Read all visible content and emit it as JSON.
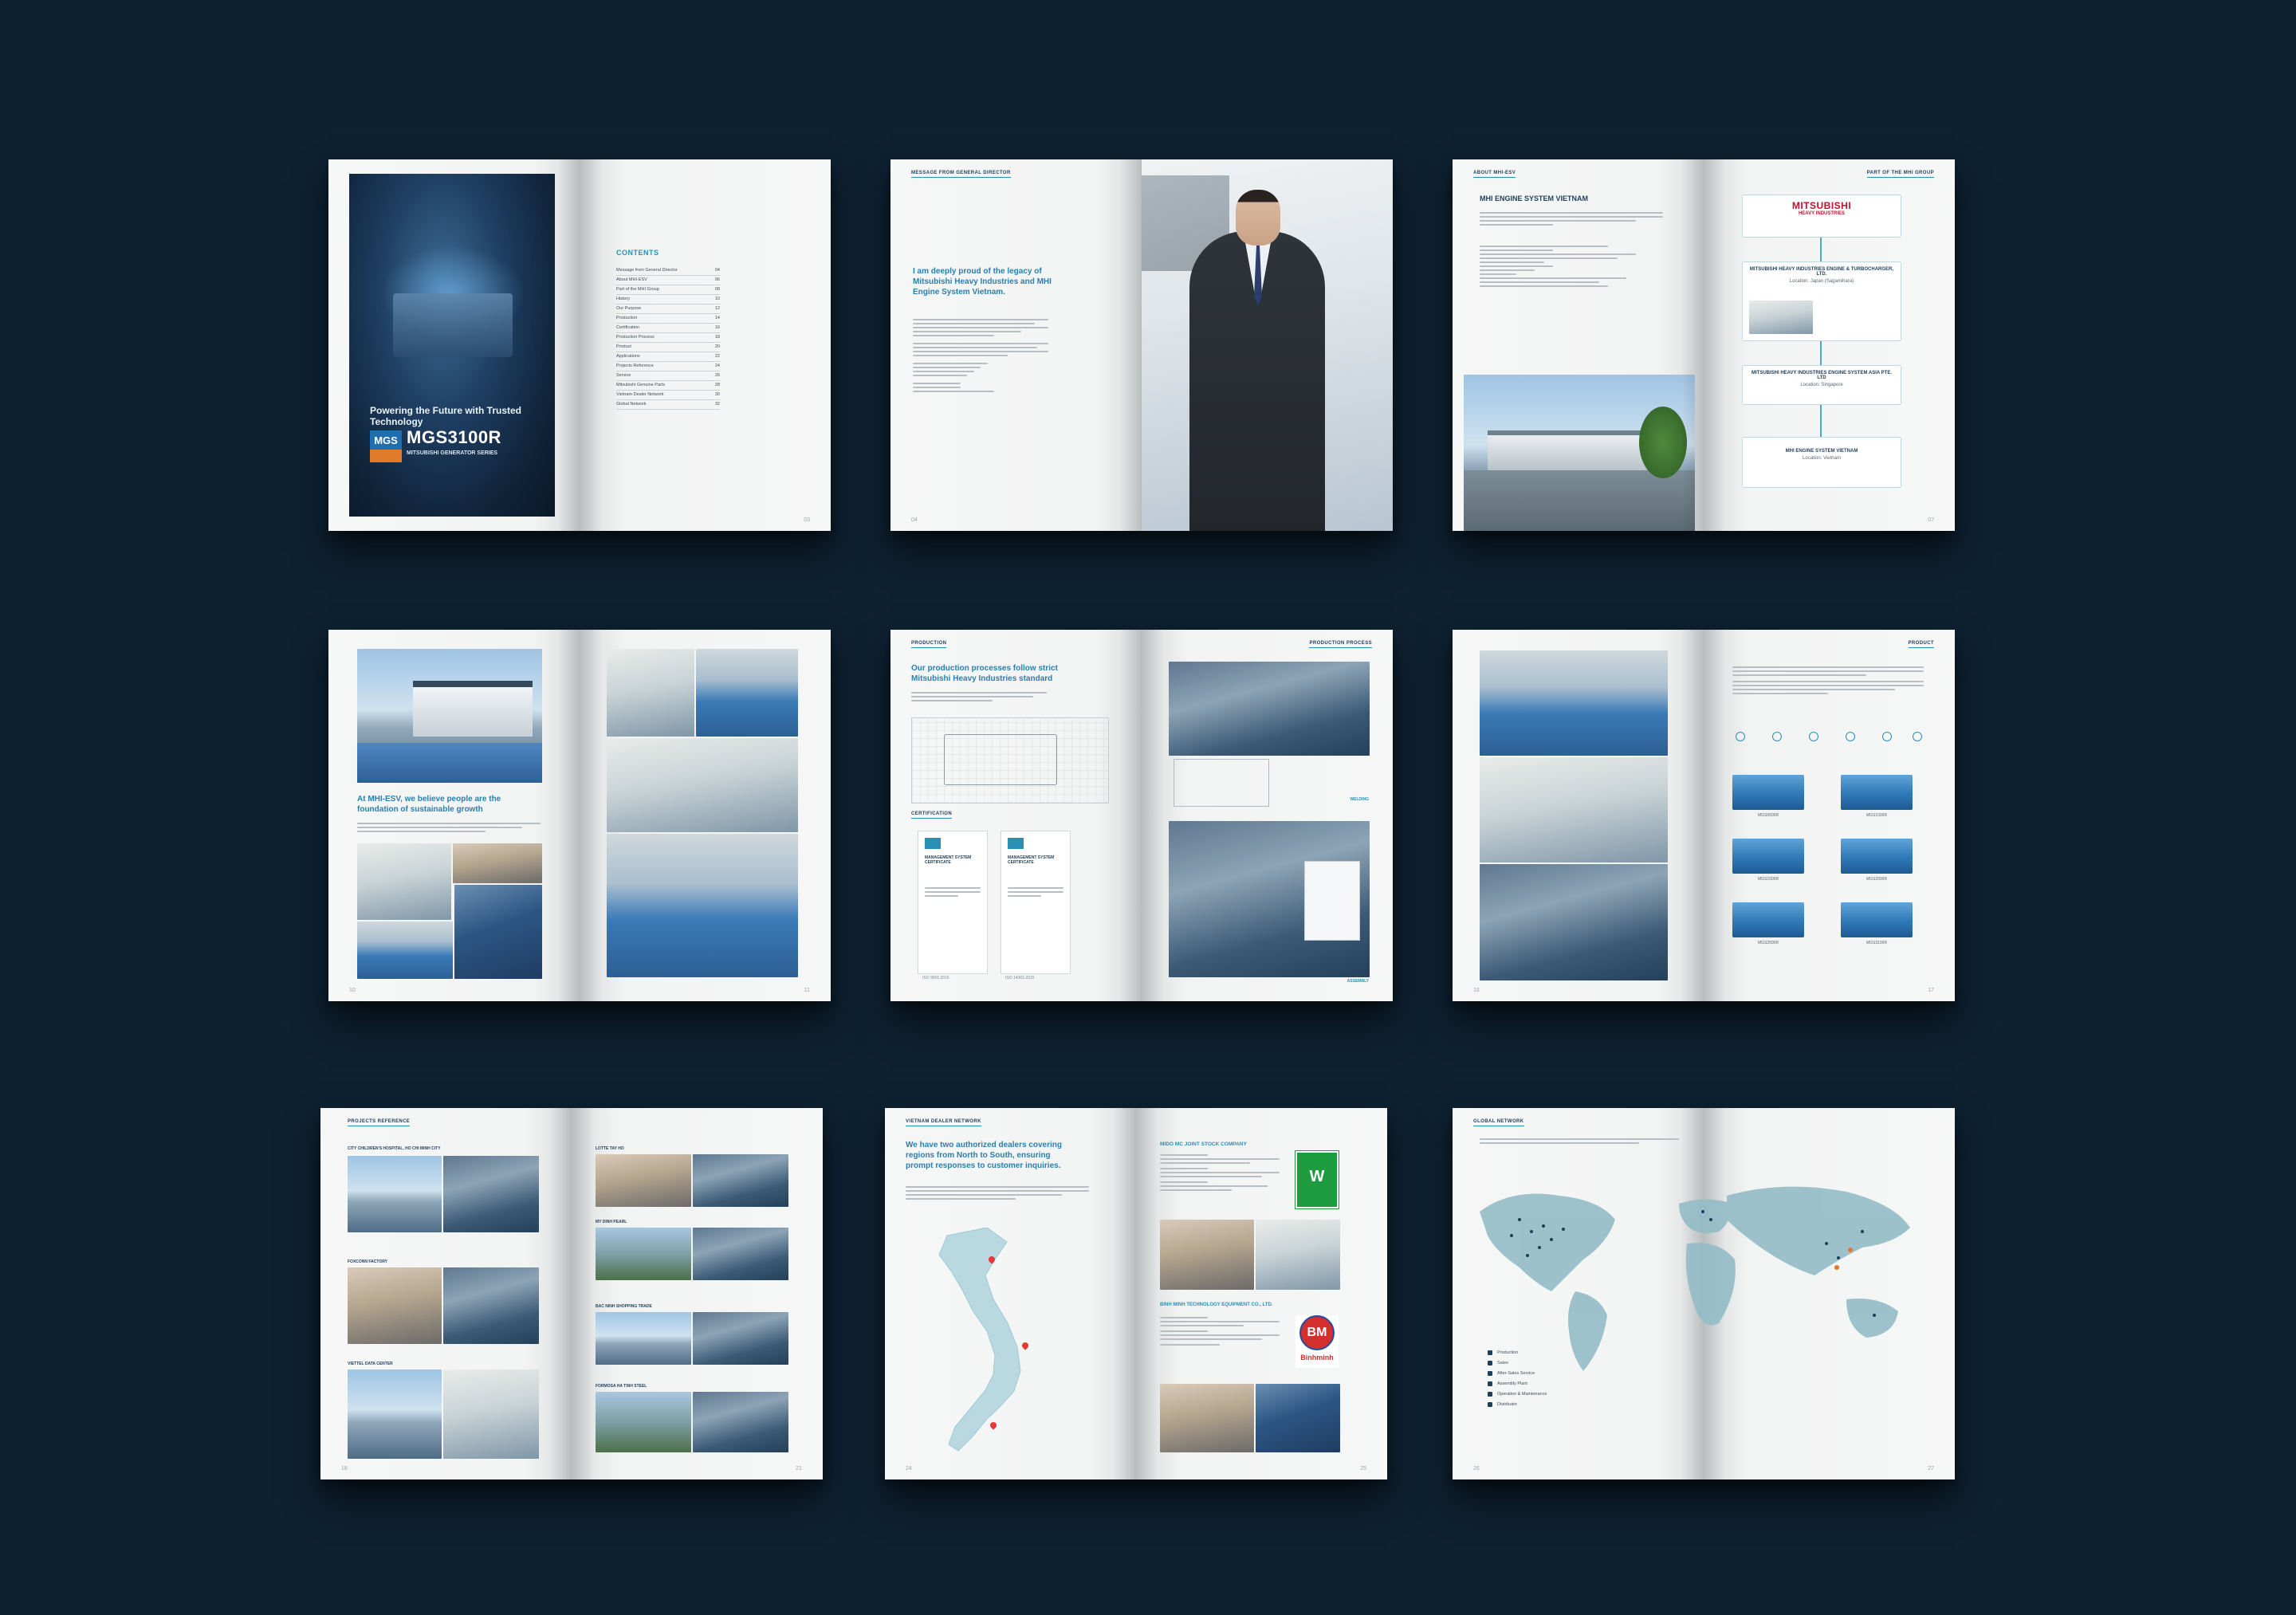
{
  "background_color": "#0e2131",
  "accent_color": "#2a8fb4",
  "spreads": {
    "cover": {
      "tagline": "Powering the Future with Trusted Technology",
      "logo_text": "MGS",
      "model": "MGS3100R",
      "series": "MITSUBISHI GENERATOR SERIES",
      "contents_title": "CONTENTS",
      "contents": [
        "Message from General Director",
        "About MHI-ESV",
        "Part of the MHI Group",
        "History",
        "Our Purpose",
        "Production",
        "Certification",
        "Production Process",
        "Product",
        "Applications",
        "Projects Reference",
        "Service",
        "Mitsubishi Genuine Parts",
        "Vietnam Dealer Network",
        "Global Network"
      ]
    },
    "director": {
      "section": "MESSAGE FROM GENERAL DIRECTOR",
      "quote": "I am deeply proud of the legacy of Mitsubishi Heavy Industries and MHI Engine System Vietnam."
    },
    "about": {
      "section": "ABOUT MHI-ESV",
      "title": "MHI ENGINE SYSTEM VIETNAM",
      "group_section": "PART OF THE MHI GROUP",
      "brand": "MITSUBISHI",
      "brand_sub": "HEAVY INDUSTRIES",
      "chain": [
        {
          "name": "MITSUBISHI HEAVY INDUSTRIES ENGINE & TURBOCHARGER, LTD.",
          "location": "Location: Japan (Sagamihara)"
        },
        {
          "name": "MITSUBISHI HEAVY INDUSTRIES ENGINE SYSTEM ASIA PTE. LTD",
          "location": "Location: Singapore"
        },
        {
          "name": "MHI ENGINE SYSTEM VIETNAM",
          "location": "Location: Vietnam"
        }
      ]
    },
    "purpose": {
      "headline": "At MHI-ESV, we believe people are the foundation of sustainable growth"
    },
    "production": {
      "section": "PRODUCTION",
      "process_section": "PRODUCTION PROCESS",
      "headline": "Our production processes follow strict Mitsubishi Heavy Industries standard",
      "cert_section": "CERTIFICATION",
      "cert_title": "MANAGEMENT SYSTEM CERTIFICATE",
      "cert_iso_1": "ISO 9001:2015",
      "cert_iso_2": "ISO 14001:2015",
      "welding": "WELDING",
      "assembly": "ASSEMBLY"
    },
    "product": {
      "section": "PRODUCT",
      "items": [
        "MGS0500R",
        "MGS1000R",
        "MGS1500R",
        "MGS2000R",
        "MGS2500R",
        "MGS3100R"
      ]
    },
    "projects": {
      "section": "PROJECTS REFERENCE",
      "items": [
        "CITY CHILDREN'S HOSPITAL, HO CHI MINH CITY",
        "FOXCONN FACTORY",
        "VIETTEL DATA CENTER",
        "LOTTE TAY HO",
        "MY DINH PEARL",
        "BAC NINH SHOPPING TRADE",
        "FORMOSA HA TINH STEEL"
      ]
    },
    "dealers": {
      "section": "VIETNAM DEALER NETWORK",
      "headline": "We have two authorized dealers covering regions from North to South, ensuring prompt responses to customer inquiries.",
      "dealer_1": "MIDO MC JOINT STOCK COMPANY",
      "dealer_1_logo": "W",
      "dealer_2": "BINH MINH TECHNOLOGY EQUIPMENT CO., LTD.",
      "dealer_2_logo": "BM",
      "dealer_2_logo_text": "Binhminh"
    },
    "global": {
      "section": "GLOBAL NETWORK",
      "legend": [
        "Production",
        "Sales",
        "After-Sales Service",
        "Assembly Plant",
        "Operation & Maintenance",
        "Distributor"
      ]
    }
  }
}
